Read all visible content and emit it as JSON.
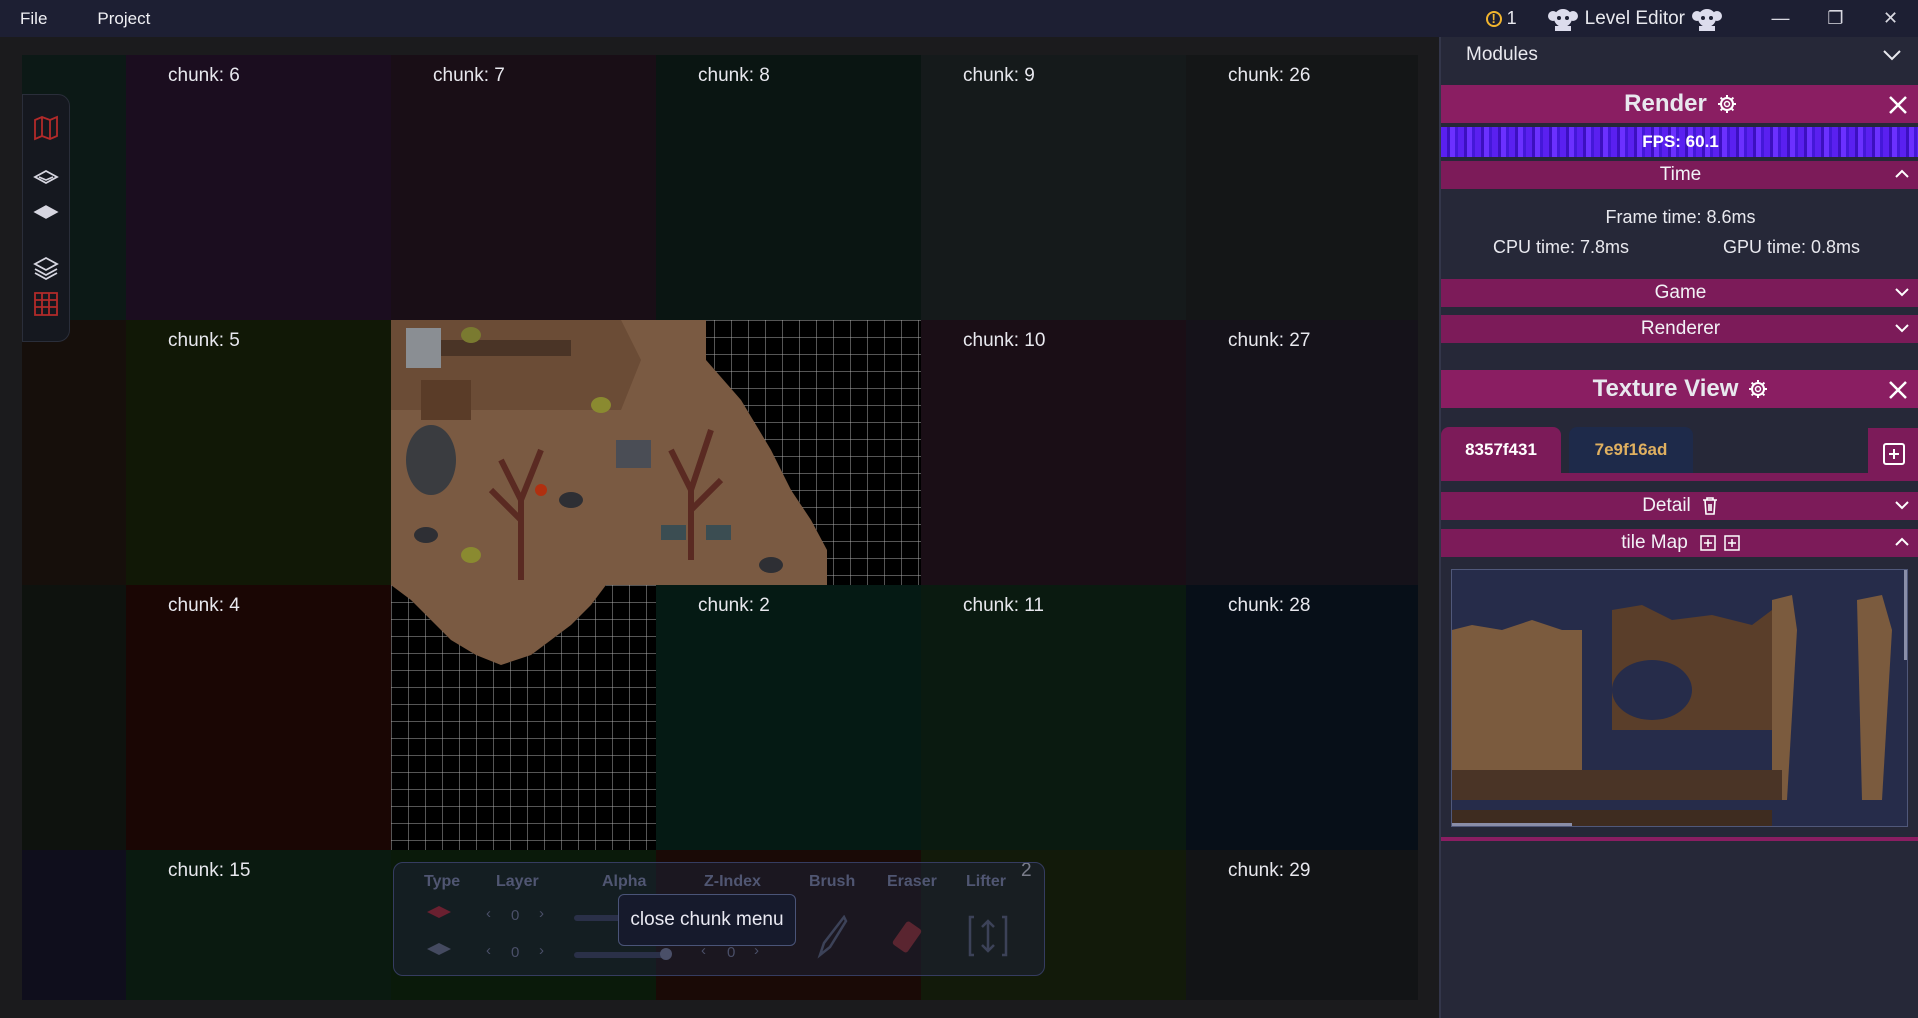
{
  "menu": {
    "file": "File",
    "project": "Project"
  },
  "titlebar": {
    "warning_count": "1",
    "title": "Level Editor",
    "minimize": "—",
    "restore": "❐",
    "close": "✕"
  },
  "chunks": [
    {
      "label": "chunk: 6"
    },
    {
      "label": "chunk: 7"
    },
    {
      "label": "chunk: 8"
    },
    {
      "label": "chunk: 9"
    },
    {
      "label": "chunk: 26"
    },
    {
      "label": "chunk: 5"
    },
    {
      "label": ""
    },
    {
      "label": ""
    },
    {
      "label": "chunk: 10"
    },
    {
      "label": "chunk: 27"
    },
    {
      "label": "chunk: 4"
    },
    {
      "label": ""
    },
    {
      "label": "chunk: 2"
    },
    {
      "label": "chunk: 11"
    },
    {
      "label": "chunk: 28"
    },
    {
      "label": "chunk: 15"
    },
    {
      "label": ""
    },
    {
      "label": ""
    },
    {
      "label": "2"
    },
    {
      "label": "chunk: 29"
    }
  ],
  "tool_panel": {
    "headers": [
      "Type",
      "Layer",
      "Alpha",
      "Z-Index",
      "Brush",
      "Eraser",
      "Lifter"
    ],
    "layer_values": [
      "0",
      "0"
    ],
    "zindex_value": "0"
  },
  "tooltip": "close chunk menu",
  "right_panel": {
    "modules": "Modules",
    "render": "Render",
    "fps": "FPS: 60.1",
    "time": "Time",
    "frame_time": "Frame time: 8.6ms",
    "cpu_time": "CPU time: 7.8ms",
    "gpu_time": "GPU time: 0.8ms",
    "game": "Game",
    "renderer": "Renderer",
    "texture_view": "Texture View",
    "tabs": [
      "8357f431",
      "7e9f16ad"
    ],
    "detail": "Detail",
    "tile_map": "tile Map"
  }
}
